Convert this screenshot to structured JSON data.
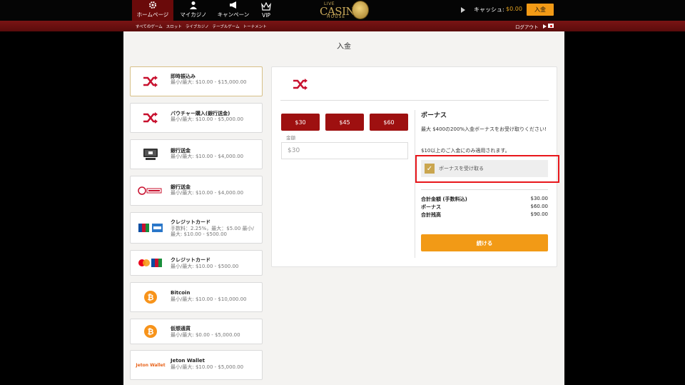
{
  "nav": {
    "items": [
      {
        "label": "ホームページ",
        "icon": "gear-icon"
      },
      {
        "label": "マイカジノ",
        "icon": "user-icon"
      },
      {
        "label": "キャンペーン",
        "icon": "megaphone-icon"
      },
      {
        "label": "VIP",
        "icon": "crown-icon"
      }
    ]
  },
  "logo": {
    "live": "LIVE",
    "casino": "CASIN",
    "house": "HOUSE"
  },
  "account": {
    "cash_label": "キャッシュ:",
    "cash_value": "$0.00",
    "deposit_label": "入金"
  },
  "subnav": {
    "items": [
      "すべてのゲーム",
      "スロット",
      "ライブカジノ",
      "テーブルゲーム",
      "トーナメント"
    ],
    "logout": "ログアウト"
  },
  "page": {
    "title": "入金"
  },
  "methods": [
    {
      "name": "即時振込み",
      "desc": "最小/最大: $10.00 - $15,000.00",
      "icon": "shuffle-icon"
    },
    {
      "name": "バウチャー購入(銀行送金)",
      "desc": "最小/最大: $10.00 - $5,000.00",
      "icon": "shuffle-icon"
    },
    {
      "name": "銀行送金",
      "desc": "最小/最大: $10.00 - $4,000.00",
      "icon": "bank-terminal-icon"
    },
    {
      "name": "銀行送金",
      "desc": "最小/最大: $10.00 - $4,000.00",
      "icon": "bank-transfer-logo-icon"
    },
    {
      "name": "クレジットカード",
      "desc": "手数料：2.25%，最大：$5.00 最小/最大: $10.00 - $500.00",
      "icon": "jcb-amex-icon"
    },
    {
      "name": "クレジットカード",
      "desc": "最小/最大: $10.00 - $500.00",
      "icon": "mastercard-jcb-icon"
    },
    {
      "name": "Bitcoin",
      "desc": "最小/最大: $10.00 - $10,000.00",
      "icon": "bitcoin-icon"
    },
    {
      "name": "仮想通貨",
      "desc": "最小/最大: $0.00 - $5,000.00",
      "icon": "bitcoin-icon"
    },
    {
      "name": "Jeton Wallet",
      "desc": "最小/最大: $10.00 - $5,000.00",
      "icon": "jeton-wallet-icon",
      "logo_text": "Jeton Wallet"
    }
  ],
  "deposit": {
    "amount_buttons": [
      "$30",
      "$45",
      "$60"
    ],
    "amount_label": "金額",
    "amount_value": "$30"
  },
  "bonus": {
    "title": "ボーナス",
    "desc": "最大 $400の200%入金ボーナスをお受け取りください!",
    "min": "$10以上のご入金にのみ適用されます。",
    "checkbox_label": "ボーナスを受け取る",
    "checked": true
  },
  "totals": [
    {
      "label": "合計金額 (手数料込)",
      "value": "$30.00"
    },
    {
      "label": "ボーナス",
      "value": "$60.00"
    },
    {
      "label": "合計残高",
      "value": "$90.00"
    }
  ],
  "continue_label": "続ける",
  "colors": {
    "accent": "#f29a16",
    "brand_red": "#9e1010",
    "highlight": "#e8161b",
    "checkbox": "#caa64f"
  }
}
